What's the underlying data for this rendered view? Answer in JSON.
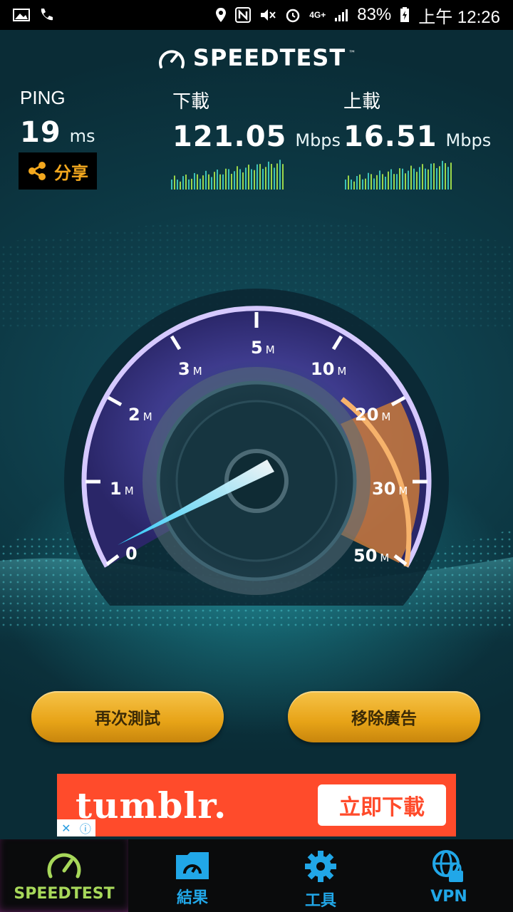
{
  "status_bar": {
    "battery": "83%",
    "network": "4G+",
    "time": "上午 12:26"
  },
  "brand": {
    "title": "SPEEDTEST",
    "tm": "™"
  },
  "metrics": {
    "ping": {
      "label": "PING",
      "value": "19",
      "unit": "ms"
    },
    "download": {
      "label": "下載",
      "value": "121.05",
      "unit": "Mbps"
    },
    "upload": {
      "label": "上載",
      "value": "16.51",
      "unit": "Mbps"
    }
  },
  "share": {
    "label": "分享",
    "icon": "share-icon"
  },
  "gauge": {
    "labels": [
      {
        "num": "0",
        "unit": ""
      },
      {
        "num": "1",
        "unit": "M"
      },
      {
        "num": "2",
        "unit": "M"
      },
      {
        "num": "3",
        "unit": "M"
      },
      {
        "num": "5",
        "unit": "M"
      },
      {
        "num": "10",
        "unit": "M"
      },
      {
        "num": "20",
        "unit": "M"
      },
      {
        "num": "30",
        "unit": "M"
      },
      {
        "num": "50",
        "unit": "M"
      }
    ],
    "colors": {
      "arc": "#c9b7ff",
      "face": "#3b3a86",
      "highlight": "#e98a34",
      "needle": "#8fe6ff"
    }
  },
  "buttons": {
    "retest": "再次測試",
    "remove_ads": "移除廣告"
  },
  "ad": {
    "brand": "tumblr.",
    "cta": "立即下載",
    "close": "✕",
    "info": "ⓘ"
  },
  "nav": {
    "items": [
      {
        "label": "SPEEDTEST",
        "icon": "speedometer-icon",
        "active": true
      },
      {
        "label": "結果",
        "icon": "results-folder-icon",
        "active": false
      },
      {
        "label": "工具",
        "icon": "gear-icon",
        "active": false
      },
      {
        "label": "VPN",
        "icon": "vpn-globe-lock-icon",
        "active": false
      }
    ]
  }
}
